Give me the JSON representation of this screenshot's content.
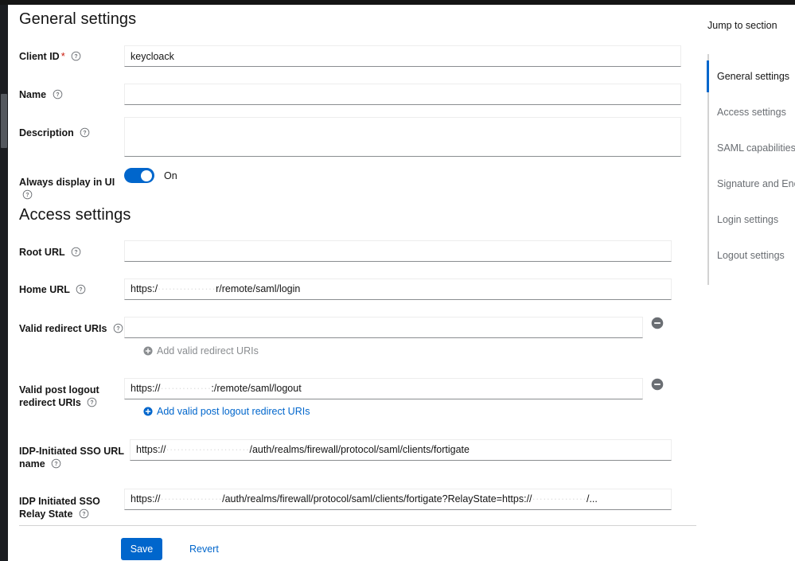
{
  "sections": {
    "general_title": "General settings",
    "access_title": "Access settings"
  },
  "fields": {
    "client_id": {
      "label": "Client ID",
      "required_marker": "*",
      "value": "keycloack"
    },
    "name": {
      "label": "Name",
      "value": ""
    },
    "description": {
      "label": "Description",
      "value": ""
    },
    "always_display": {
      "label": "Always display in UI",
      "state_label": "On",
      "checked": true
    },
    "root_url": {
      "label": "Root URL",
      "value": ""
    },
    "home_url": {
      "label": "Home URL",
      "value_prefix": "https:/",
      "value_redacted": "················",
      "value_suffix": "r/remote/saml/login"
    },
    "valid_redirect_uris": {
      "label": "Valid redirect URIs",
      "value": "",
      "add_label": "Add valid redirect URIs",
      "add_enabled": false,
      "remove_label": "Remove"
    },
    "valid_post_logout_redirect_uris": {
      "label_line1": "Valid post logout",
      "label_line2": "redirect URIs",
      "value_prefix": "https://",
      "value_redacted": "··············",
      "value_suffix": ":/remote/saml/logout",
      "add_label": "Add valid post logout redirect URIs",
      "add_enabled": true,
      "remove_label": "Remove"
    },
    "idp_initiated_sso_url_name": {
      "label_line1": "IDP-Initiated SSO URL",
      "label_line2": "name",
      "value_prefix": "https://",
      "value_redacted": "·······················",
      "value_suffix": "/auth/realms/firewall/protocol/saml/clients/fortigate"
    },
    "idp_initiated_sso_relay_state": {
      "label_line1": "IDP Initiated SSO",
      "label_line2": "Relay State",
      "value_prefix": "https://",
      "value_redacted": "·················",
      "value_middle": "/auth/realms/firewall/protocol/saml/clients/fortigate?RelayState=https://",
      "value_redacted2": "···············",
      "value_suffix": "/..."
    }
  },
  "footer": {
    "save_label": "Save",
    "revert_label": "Revert"
  },
  "jump_to_section": {
    "title": "Jump to section",
    "items": [
      {
        "label": "General settings",
        "active": true
      },
      {
        "label": "Access settings",
        "active": false
      },
      {
        "label": "SAML capabilities",
        "active": false
      },
      {
        "label": "Signature and Encryption",
        "active": false
      },
      {
        "label": "Login settings",
        "active": false
      },
      {
        "label": "Logout settings",
        "active": false
      }
    ]
  },
  "colors": {
    "accent": "#0066cc",
    "required": "#c9190b",
    "text": "#151515",
    "muted": "#6a6e73",
    "disabled": "#8a8d90"
  }
}
